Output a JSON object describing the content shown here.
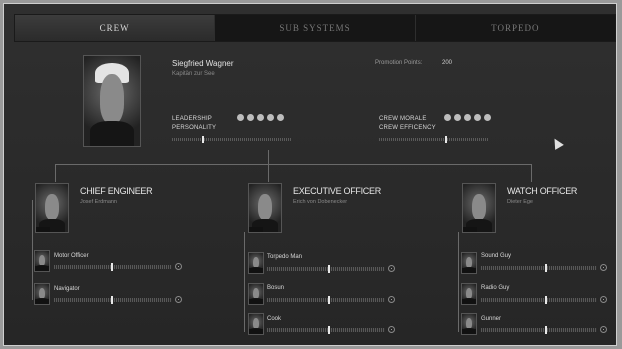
{
  "tabs": [
    {
      "label": "CREW",
      "active": true
    },
    {
      "label": "SUB SYSTEMS",
      "active": false
    },
    {
      "label": "TORPEDO",
      "active": false
    }
  ],
  "captain": {
    "name": "Siegfried Wagner",
    "rank": "Kapitän zur See",
    "promotion_label": "Promotion Points:",
    "promotion_points": "200",
    "stats": {
      "leadership": {
        "label": "LEADERSHIP",
        "dots": 5
      },
      "personality": {
        "label": "PERSONALITY",
        "level": 0.25
      },
      "crew_morale": {
        "label": "CREW MORALE",
        "dots": 5
      },
      "crew_efficiency": {
        "label": "CREW EFFICENCY",
        "level": 0.6
      }
    }
  },
  "officers": [
    {
      "title": "CHIEF ENGINEER",
      "name": "Josef Erdmann",
      "crew": [
        {
          "label": "Motor Officer",
          "level": 0.48
        },
        {
          "label": "Navigator",
          "level": 0.48
        }
      ]
    },
    {
      "title": "EXECUTIVE OFFICER",
      "name": "Erich von Dobenecker",
      "crew": [
        {
          "label": "Torpedo Man",
          "level": 0.52
        },
        {
          "label": "Bosun",
          "level": 0.52
        },
        {
          "label": "Cook",
          "level": 0.52
        }
      ]
    },
    {
      "title": "WATCH OFFICER",
      "name": "Dieter Ege",
      "crew": [
        {
          "label": "Sound Guy",
          "level": 0.55
        },
        {
          "label": "Radio Guy",
          "level": 0.55
        },
        {
          "label": "Gunner",
          "level": 0.55
        }
      ]
    }
  ],
  "icons": {
    "portrait": "portrait-icon",
    "knob": "circle-knob-icon",
    "cursor": "mouse-pointer-icon"
  }
}
